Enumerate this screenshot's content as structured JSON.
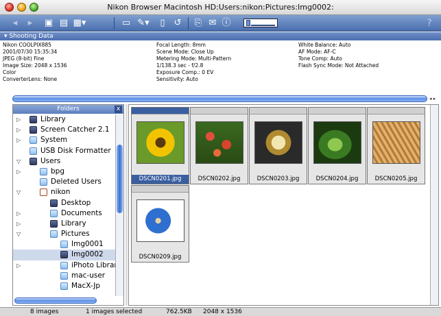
{
  "window": {
    "title": "Nikon Browser Macintosh HD:Users:nikon:Pictures:Img0002:"
  },
  "toolbar": {
    "help": "?",
    "icons": [
      "back-icon",
      "forward-icon",
      "new-folder-icon",
      "folder-open-icon",
      "folder-menu-icon",
      "open-folder-icon",
      "edit-icon",
      "document-icon",
      "rotate-icon",
      "copy-icon",
      "mail-icon",
      "info-icon",
      "thumbnail-size-slider"
    ]
  },
  "shooting_data": {
    "header": "Shooting Data",
    "col1": [
      "Nikon COOLPIX885",
      "2001/07/30 15:35:34",
      "JPEG (8-bit) Fine",
      "Image Size: 2048 x 1536",
      "Color",
      "ConverterLens: None"
    ],
    "col2": [
      "Focal Length: 8mm",
      "Scene Mode: Close Up",
      "Metering Mode: Multi-Pattern",
      "1/138.3 sec - f/2.8",
      "Exposure Comp.: 0 EV",
      "Sensitivity: Auto"
    ],
    "col3": [
      "White Balance: Auto",
      "AF Mode: AF-C",
      "Tone Comp: Auto",
      "Flash Sync Mode: Not Attached"
    ]
  },
  "folders": {
    "header": "Folders",
    "close": "x",
    "rows": [
      {
        "label": "Library",
        "tri": "▷",
        "indent": 1,
        "icon": "library-folder-icon"
      },
      {
        "label": "Screen Catcher 2.1",
        "tri": "▷",
        "indent": 1,
        "icon": "app-icon"
      },
      {
        "label": "System",
        "tri": "▷",
        "indent": 1,
        "icon": "folder-icon"
      },
      {
        "label": "USB Disk Formatter",
        "tri": "",
        "indent": 1,
        "icon": "folder-icon"
      },
      {
        "label": "Users",
        "tri": "▽",
        "indent": 1,
        "icon": "users-folder-icon"
      },
      {
        "label": "bpg",
        "tri": "▷",
        "indent": 2,
        "icon": "folder-icon"
      },
      {
        "label": "Deleted Users",
        "tri": "",
        "indent": 2,
        "icon": "folder-icon"
      },
      {
        "label": "nikon",
        "tri": "▽",
        "indent": 2,
        "icon": "home-icon"
      },
      {
        "label": "Desktop",
        "tri": "",
        "indent": 3,
        "icon": "desktop-folder-icon"
      },
      {
        "label": "Documents",
        "tri": "▷",
        "indent": 3,
        "icon": "folder-icon"
      },
      {
        "label": "Library",
        "tri": "▷",
        "indent": 3,
        "icon": "library-folder-icon"
      },
      {
        "label": "Pictures",
        "tri": "▽",
        "indent": 3,
        "icon": "folder-icon"
      },
      {
        "label": "Img0001",
        "tri": "",
        "indent": 4,
        "icon": "folder-icon"
      },
      {
        "label": "Img0002",
        "tri": "",
        "indent": 4,
        "icon": "folder-open-icon",
        "selected": true
      },
      {
        "label": "iPhoto Library",
        "tri": "▷",
        "indent": 4,
        "icon": "folder-icon"
      },
      {
        "label": "mac-user",
        "tri": "",
        "indent": 4,
        "icon": "folder-icon"
      },
      {
        "label": "MacX-Jp",
        "tri": "",
        "indent": 4,
        "icon": "folder-icon"
      }
    ]
  },
  "thumbnails": [
    {
      "name": "DSCN0201.jpg",
      "selected": true,
      "kind": "sunflower"
    },
    {
      "name": "DSCN0202.jpg",
      "selected": false,
      "kind": "flowers"
    },
    {
      "name": "DSCN0203.jpg",
      "selected": false,
      "kind": "watch"
    },
    {
      "name": "DSCN0204.jpg",
      "selected": false,
      "kind": "leaf"
    },
    {
      "name": "DSCN0205.jpg",
      "selected": false,
      "kind": "wheat"
    },
    {
      "name": "DSCN0209.jpg",
      "selected": false,
      "kind": "blueflower"
    }
  ],
  "status": {
    "images": "8 images",
    "selected": "1 images selected",
    "size": "762.5KB",
    "dimensions": "2048 x 1536"
  },
  "colors": {
    "toolbar": "#4a6fae",
    "selection": "#3a5fa0"
  }
}
